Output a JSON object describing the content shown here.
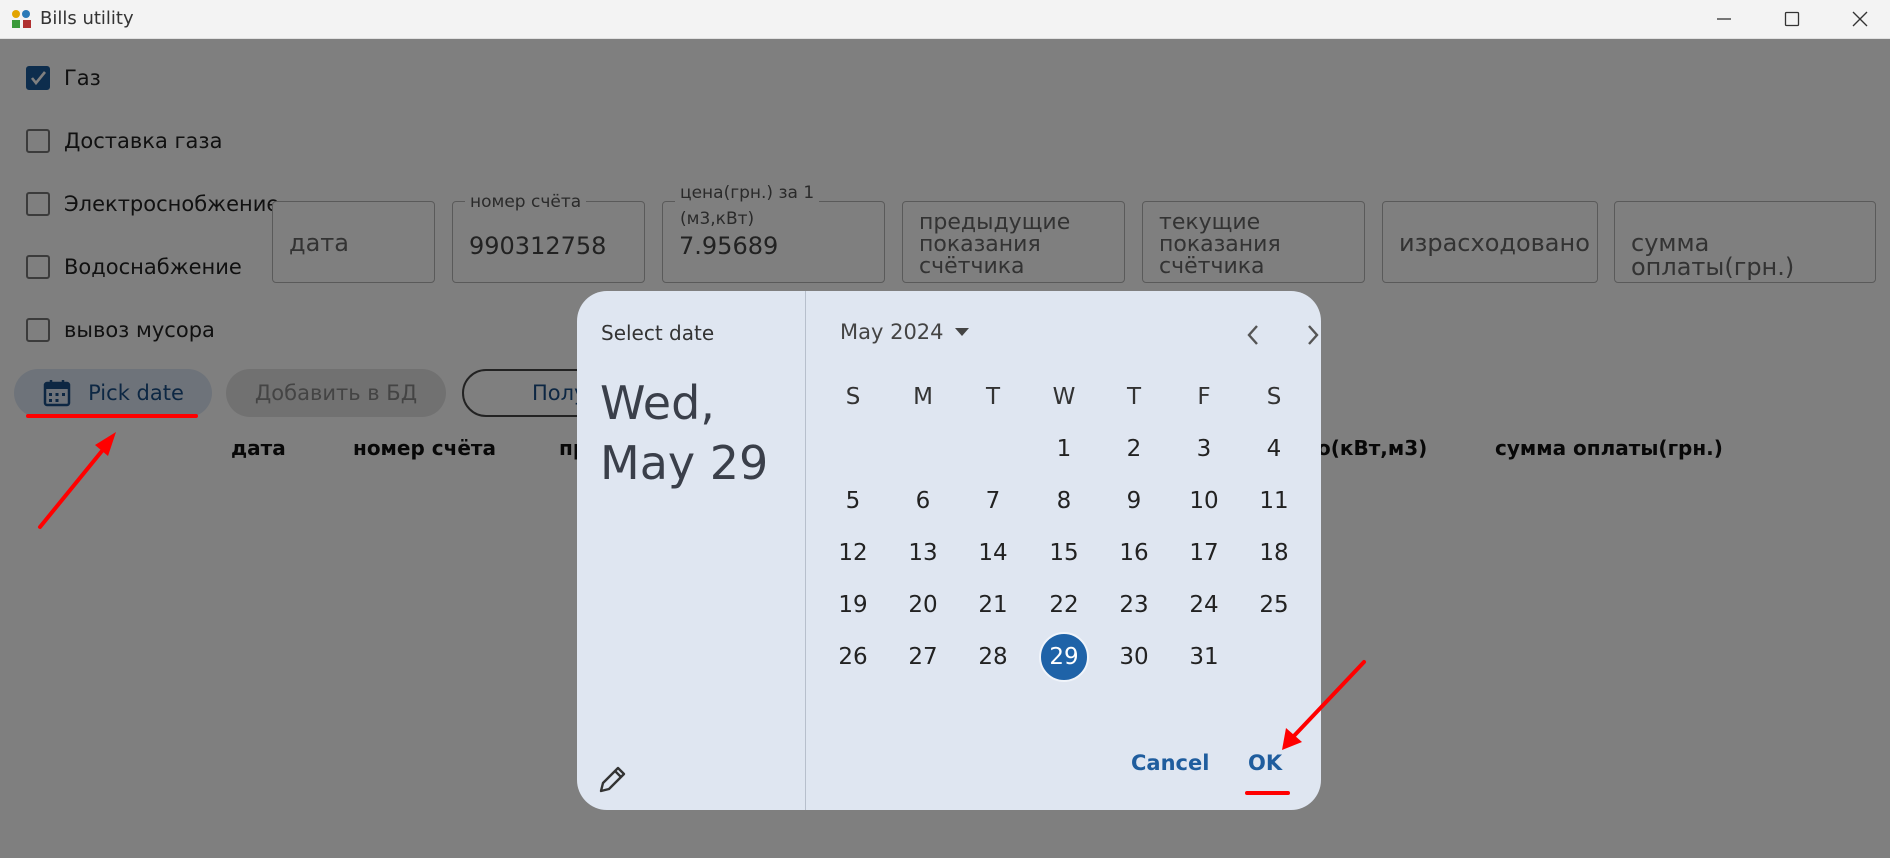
{
  "window": {
    "title": "Bills utility"
  },
  "services": [
    {
      "label": "Газ",
      "checked": true
    },
    {
      "label": "Доставка газа",
      "checked": false
    },
    {
      "label": "Электроснобжение",
      "checked": false
    },
    {
      "label": "Водоснабжение",
      "checked": false
    },
    {
      "label": "вывоз мусора",
      "checked": false
    }
  ],
  "fields": {
    "date": {
      "placeholder": "дата"
    },
    "account": {
      "label": "номер счёта",
      "value": "990312758"
    },
    "price": {
      "label_line1": "цена(грн.) за 1",
      "label_line2": "(м3,кВт)",
      "value": "7.95689"
    },
    "prev_reading": {
      "placeholder_line1": "предыдущие",
      "placeholder_line2": "показания",
      "placeholder_line3": "счётчика"
    },
    "curr_reading": {
      "placeholder_line1": "текущие",
      "placeholder_line2": "показания",
      "placeholder_line3": "счётчика"
    },
    "consumed": {
      "placeholder": "израсходовано"
    },
    "amount": {
      "placeholder": "сумма оплаты(грн.)"
    }
  },
  "buttons": {
    "pick_date": "Pick date",
    "add_db": "Добавить в БД",
    "third": "Полу"
  },
  "table_headers": {
    "date": "дата",
    "account": "номер счёта",
    "partial": "пр",
    "consumed_partial": "о(кВт,м3)",
    "amount": "сумма оплаты(грн.)"
  },
  "dialog": {
    "select_label": "Select date",
    "date_line1": "Wed,",
    "date_line2": "May 29",
    "month_label": "May 2024",
    "weekdays": [
      "S",
      "M",
      "T",
      "W",
      "T",
      "F",
      "S"
    ],
    "days": [
      "1",
      "2",
      "3",
      "4",
      "5",
      "6",
      "7",
      "8",
      "9",
      "10",
      "11",
      "12",
      "13",
      "14",
      "15",
      "16",
      "17",
      "18",
      "19",
      "20",
      "21",
      "22",
      "23",
      "24",
      "25",
      "26",
      "27",
      "28",
      "29",
      "30",
      "31"
    ],
    "selected_day": "29",
    "cancel": "Cancel",
    "ok": "OK"
  },
  "colors": {
    "accent": "#1f63a8",
    "annotation": "#ff0000"
  }
}
